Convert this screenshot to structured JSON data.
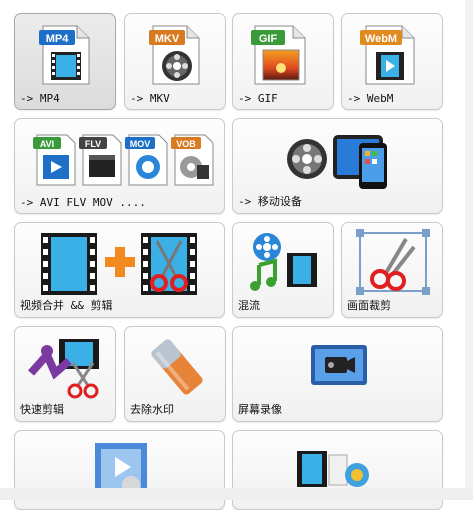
{
  "tiles": [
    {
      "label": "-> MP4",
      "badge": "MP4",
      "badge_color": "#1e6fc8"
    },
    {
      "label": "-> MKV",
      "badge": "MKV",
      "badge_color": "#d87a1f"
    },
    {
      "label": "-> GIF",
      "badge": "GIF",
      "badge_color": "#3a9a3a"
    },
    {
      "label": "-> WebM",
      "badge": "WebM",
      "badge_color": "#e08a20"
    },
    {
      "label": "-> AVI FLV MOV ....",
      "badges": [
        "AVI",
        "FLV",
        "MOV",
        "VOB"
      ]
    },
    {
      "label": "-> 移动设备"
    },
    {
      "label": "视频合并 && 剪辑"
    },
    {
      "label": "混流"
    },
    {
      "label": "画面裁剪"
    },
    {
      "label": "快速剪辑"
    },
    {
      "label": "去除水印"
    },
    {
      "label": "屏幕录像"
    }
  ],
  "colors": {
    "selected_tile": "#e2e2e2",
    "tile_border": "#c9c9c9"
  }
}
